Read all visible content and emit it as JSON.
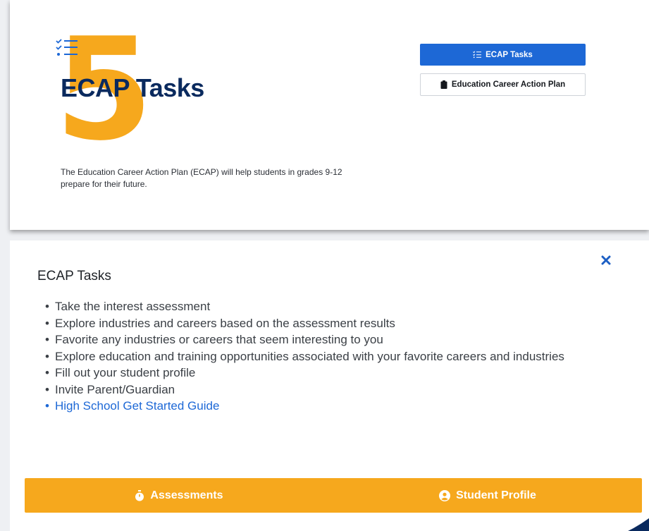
{
  "hero": {
    "big_number": "5",
    "title": "ECAP Tasks",
    "description": "The Education Career Action Plan (ECAP) will help students in grades 9-12 prepare for their future.",
    "list_icon": "checklist-icon"
  },
  "buttons": {
    "primary_label": "ECAP Tasks",
    "primary_icon": "checklist-icon",
    "secondary_label": "Education Career Action Plan",
    "secondary_icon": "clipboard-icon"
  },
  "modal": {
    "title": "ECAP Tasks",
    "close_icon": "close-icon",
    "tasks": [
      "Take the interest assessment",
      "Explore industries and careers based on the assessment results",
      "Favorite any industries or careers that seem interesting to you",
      "Explore education and training opportunities associated with your favorite careers and industries",
      "Fill out your student profile",
      "Invite Parent/Guardian",
      "High School Get Started Guide"
    ],
    "actions": [
      {
        "label": "Assessments",
        "icon": "stopwatch-icon"
      },
      {
        "label": "Student Profile",
        "icon": "user-circle-icon"
      }
    ]
  },
  "colors": {
    "accent_orange": "#f6a81d",
    "primary_blue": "#1d68d6",
    "title_navy": "#0a2a5e"
  }
}
